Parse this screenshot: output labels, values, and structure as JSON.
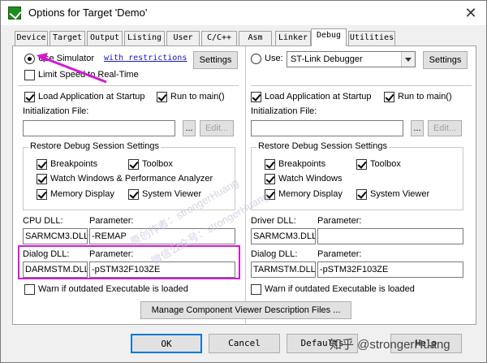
{
  "window": {
    "title": "Options for Target 'Demo'",
    "close_glyph": "✕"
  },
  "tabs": [
    {
      "label": "Device"
    },
    {
      "label": "Target"
    },
    {
      "label": "Output"
    },
    {
      "label": "Listing"
    },
    {
      "label": "User"
    },
    {
      "label": "C/C++"
    },
    {
      "label": "Asm"
    },
    {
      "label": "Linker"
    },
    {
      "label": "Debug",
      "active": true
    },
    {
      "label": "Utilities"
    }
  ],
  "left": {
    "use_simulator": {
      "label": "Use Simulator",
      "selected": true
    },
    "restrictions_link": "with restrictions",
    "settings_btn": "Settings",
    "limit_speed": {
      "label": "Limit Speed to Real-Time",
      "checked": false
    },
    "load_app": {
      "label": "Load Application at Startup",
      "checked": true
    },
    "run_main": {
      "label": "Run to main()",
      "checked": true
    },
    "init_file_label": "Initialization File:",
    "init_file_value": "",
    "browse_btn": "...",
    "edit_btn": "Edit...",
    "restore_group": {
      "title": "Restore Debug Session Settings",
      "breakpoints": {
        "label": "Breakpoints",
        "checked": true
      },
      "toolbox": {
        "label": "Toolbox",
        "checked": true
      },
      "watch": {
        "label": "Watch Windows & Performance Analyzer",
        "checked": true
      },
      "memory": {
        "label": "Memory Display",
        "checked": true
      },
      "sysviewer": {
        "label": "System Viewer",
        "checked": true
      }
    },
    "cpu_dll": {
      "label": "CPU DLL:",
      "value": "SARMCM3.DLL",
      "param_label": "Parameter:",
      "param_value": "-REMAP"
    },
    "dialog_dll": {
      "label": "Dialog DLL:",
      "value": "DARMSTM.DLL",
      "param_label": "Parameter:",
      "param_value": "-pSTM32F103ZE"
    },
    "warn_outdated": {
      "label": "Warn if outdated Executable is loaded",
      "checked": false
    }
  },
  "right": {
    "use": {
      "label": "Use:",
      "selected": false
    },
    "debugger_select": "ST-Link Debugger",
    "settings_btn": "Settings",
    "load_app": {
      "label": "Load Application at Startup",
      "checked": true
    },
    "run_main": {
      "label": "Run to main()",
      "checked": true
    },
    "init_file_label": "Initialization File:",
    "init_file_value": "",
    "browse_btn": "...",
    "edit_btn": "Edit...",
    "restore_group": {
      "title": "Restore Debug Session Settings",
      "breakpoints": {
        "label": "Breakpoints",
        "checked": true
      },
      "toolbox": {
        "label": "Toolbox",
        "checked": true
      },
      "watch": {
        "label": "Watch Windows",
        "checked": true
      },
      "memory": {
        "label": "Memory Display",
        "checked": true
      },
      "sysviewer": {
        "label": "System Viewer",
        "checked": true
      }
    },
    "driver_dll": {
      "label": "Driver DLL:",
      "value": "SARMCM3.DLL",
      "param_label": "Parameter:",
      "param_value": ""
    },
    "dialog_dll": {
      "label": "Dialog DLL:",
      "value": "TARMSTM.DLL",
      "param_label": "Parameter:",
      "param_value": "-pSTM32F103ZE"
    },
    "warn_outdated": {
      "label": "Warn if outdated Executable is loaded",
      "checked": false
    }
  },
  "manage_btn": "Manage Component Viewer Description Files ...",
  "footer": {
    "ok": "OK",
    "cancel": "Cancel",
    "defaults": "Defaults",
    "help": "Help"
  },
  "overlay": {
    "watermark": "知乎 @strongerHuang",
    "diag1": "原创作者：strongerHuang",
    "diag2": "微信公众号：strongerHuang"
  },
  "colors": {
    "highlight": "#d21bd2",
    "arrow": "#d21bd2",
    "link": "#1a1ab8",
    "accent": "#0078d7"
  }
}
